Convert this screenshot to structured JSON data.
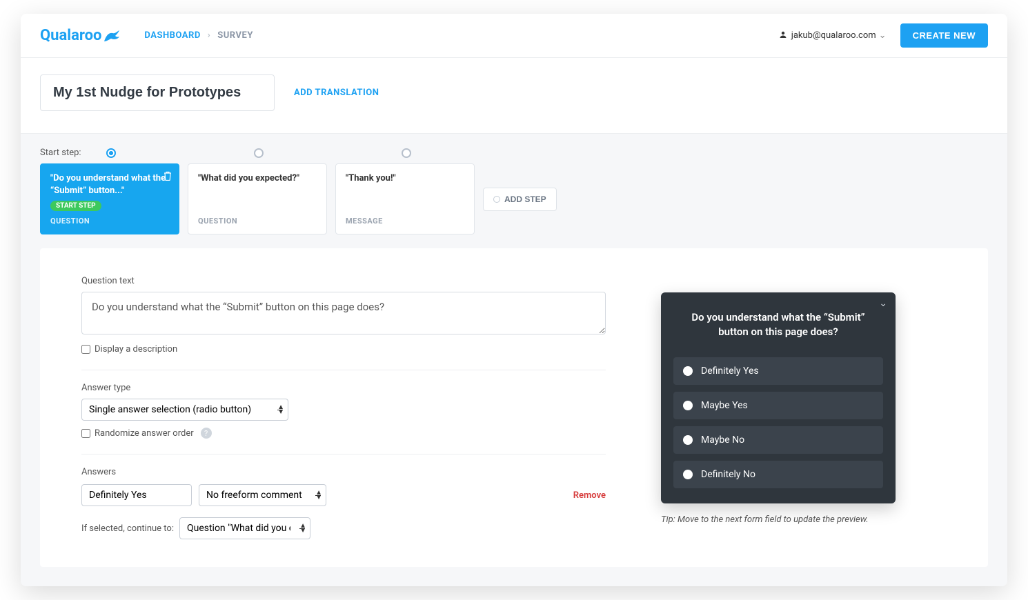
{
  "header": {
    "logo_text": "Qualaroo",
    "breadcrumb": {
      "dashboard": "DASHBOARD",
      "current": "SURVEY"
    },
    "user_email": "jakub@qualaroo.com",
    "create_new": "CREATE NEW"
  },
  "title_row": {
    "nudge_title": "My 1st Nudge for Prototypes",
    "add_translation": "ADD TRANSLATION"
  },
  "steps": {
    "start_step_label": "Start step:",
    "add_step": "ADD STEP",
    "cards": [
      {
        "title": "\"Do you understand what the “Submit” button...\"",
        "badge": "START STEP",
        "type": "QUESTION",
        "active": true
      },
      {
        "title": "\"What did you expected?\"",
        "type": "QUESTION",
        "active": false
      },
      {
        "title": "\"Thank you!\"",
        "type": "MESSAGE",
        "active": false
      }
    ]
  },
  "editor": {
    "question_text_label": "Question text",
    "question_text_value": "Do you understand what the “Submit” button on this page does?",
    "display_description": "Display a description",
    "answer_type_label": "Answer type",
    "answer_type_value": "Single answer selection (radio button)",
    "randomize_label": "Randomize answer order",
    "answers_label": "Answers",
    "remove_label": "Remove",
    "answer_value": "Definitely Yes",
    "freeform_value": "No freeform comment",
    "continue_label": "If selected, continue to:",
    "continue_value": "Question \"What did you expect"
  },
  "preview": {
    "question": "Do you understand what the “Submit” button on this page does?",
    "options": [
      "Definitely Yes",
      "Maybe Yes",
      "Maybe No",
      "Definitely No"
    ],
    "tip": "Tip: Move to the next form field to update the preview."
  }
}
